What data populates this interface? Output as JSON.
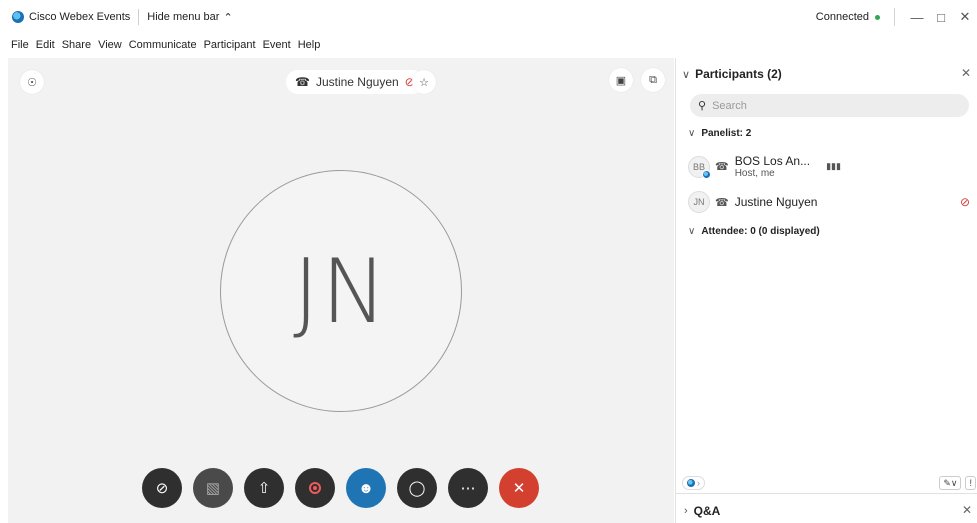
{
  "titlebar": {
    "app_title": "Cisco Webex Events",
    "hide_menu_label": "Hide menu bar",
    "connection_status": "Connected"
  },
  "menu": [
    "File",
    "Edit",
    "Share",
    "View",
    "Communicate",
    "Participant",
    "Event",
    "Help"
  ],
  "stage": {
    "active_speaker": "Justine Nguyen",
    "avatar_initials": "JN"
  },
  "panel": {
    "title": "Participants (2)",
    "search_placeholder": "Search",
    "panelist_group": "Panelist: 2",
    "attendee_group": "Attendee: 0 (0 displayed)",
    "participants": [
      {
        "initials": "BB",
        "name": "BOS Los An...",
        "role": "Host, me"
      },
      {
        "initials": "JN",
        "name": "Justine Nguyen",
        "role": ""
      }
    ],
    "qa_title": "Q&A"
  },
  "colors": {
    "accent_blue": "#1f74b3",
    "end_red": "#d3402f",
    "connected_green": "#2fa84f",
    "muted_red": "#d23c3c"
  },
  "icons": {
    "mute": "microphone-slash-icon",
    "video": "video-off-icon",
    "share": "share-icon",
    "record": "record-icon",
    "participants": "participants-icon",
    "chat": "chat-icon",
    "more": "more-icon",
    "end": "close-icon"
  }
}
